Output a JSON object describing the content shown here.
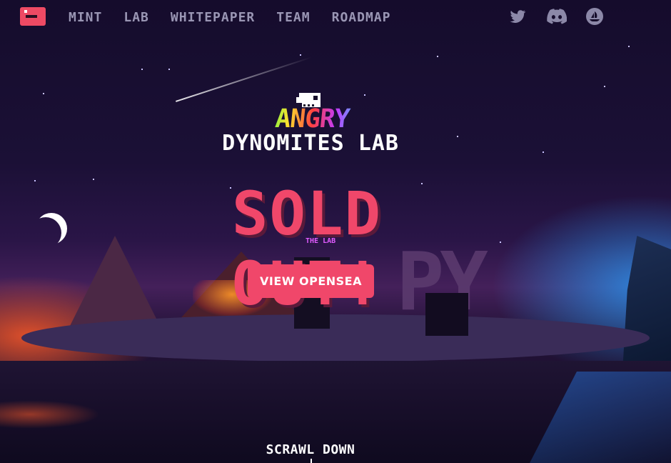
{
  "header": {
    "logo_icon": "angry-dino-logo-icon",
    "nav": [
      {
        "label": "MINT"
      },
      {
        "label": "LAB"
      },
      {
        "label": "WHITEPAPER"
      },
      {
        "label": "TEAM"
      },
      {
        "label": "ROADMAP"
      }
    ],
    "social": [
      {
        "icon": "twitter-icon"
      },
      {
        "icon": "discord-icon"
      },
      {
        "icon": "opensea-icon"
      }
    ]
  },
  "hero": {
    "brand_top": "ANGRY",
    "brand_bottom": "DYNOMITES LAB",
    "headline": "SOLD OUT!",
    "cta_label": "VIEW OPENSEA",
    "building_sign": "THE LAB",
    "scroll_label": "SCRAWL DOWN"
  },
  "colors": {
    "accent": "#f0476a",
    "nav_text": "#9a96b4",
    "background": "#160d2b"
  }
}
